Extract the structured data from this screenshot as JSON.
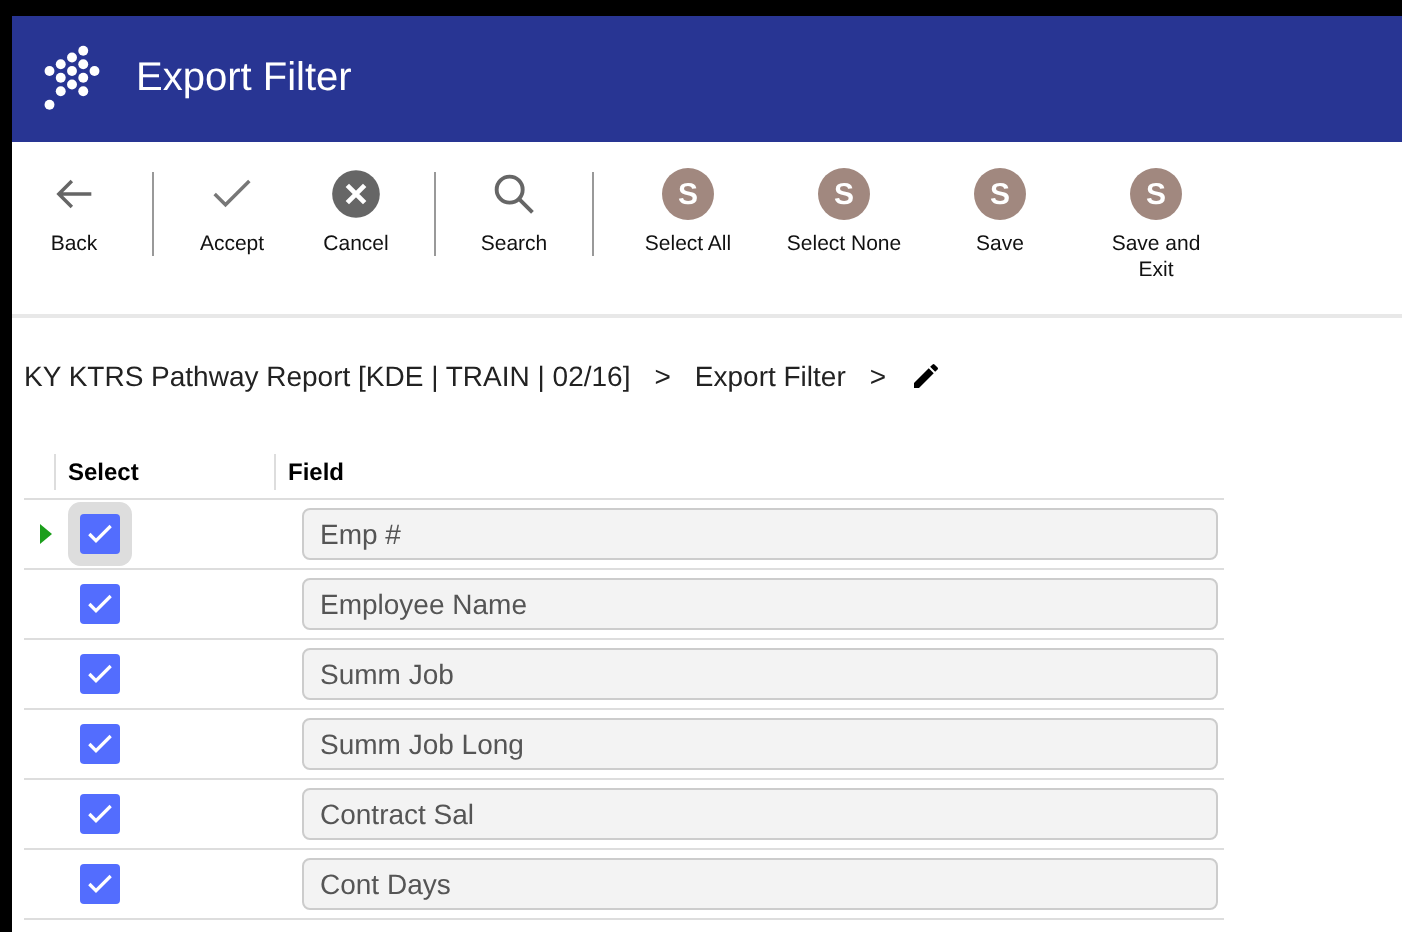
{
  "window": {
    "title": "Export Filter"
  },
  "toolbar": [
    {
      "kind": "back",
      "label": "Back",
      "separator_after": true
    },
    {
      "kind": "accept",
      "label": "Accept",
      "separator_after": false
    },
    {
      "kind": "cancel",
      "label": "Cancel",
      "separator_after": true
    },
    {
      "kind": "search",
      "label": "Search",
      "separator_after": true
    },
    {
      "kind": "letter",
      "icon_letter": "S",
      "label": "Select All",
      "separator_after": false
    },
    {
      "kind": "letter",
      "icon_letter": "S",
      "label": "Select None",
      "separator_after": false
    },
    {
      "kind": "letter",
      "icon_letter": "S",
      "label": "Save",
      "separator_after": false
    },
    {
      "kind": "letter",
      "icon_letter": "S",
      "label": "Save and Exit",
      "separator_after": false
    }
  ],
  "breadcrumb": {
    "items": [
      "KY KTRS Pathway Report [KDE | TRAIN | 02/16]",
      "Export Filter"
    ],
    "separator": ">"
  },
  "table": {
    "columns": [
      "Select",
      "Field"
    ],
    "rows": [
      {
        "current": true,
        "checked": true,
        "field": "Emp #"
      },
      {
        "current": false,
        "checked": true,
        "field": "Employee Name"
      },
      {
        "current": false,
        "checked": true,
        "field": "Summ Job"
      },
      {
        "current": false,
        "checked": true,
        "field": "Summ Job Long"
      },
      {
        "current": false,
        "checked": true,
        "field": "Contract Sal"
      },
      {
        "current": false,
        "checked": true,
        "field": "Cont Days"
      }
    ]
  }
}
